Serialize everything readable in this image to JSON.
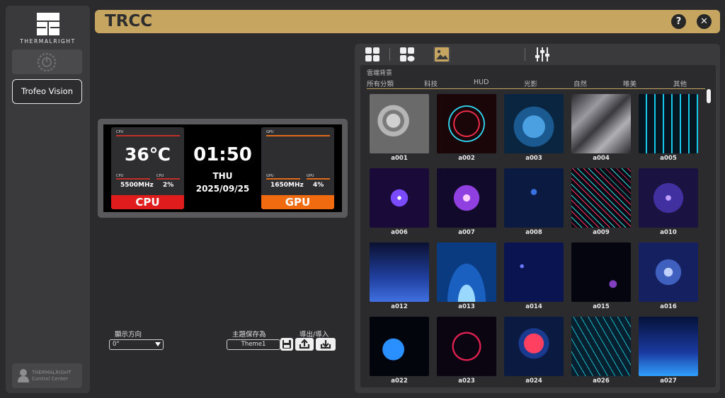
{
  "app": {
    "title": "TRCC"
  },
  "brand": {
    "logo_text": "THERMALRIGHT"
  },
  "sidebar": {
    "device_button_label": "Trofeo Vision",
    "control_center": {
      "line1": "THERMALRIGHT",
      "line2": "Control Center"
    }
  },
  "titlebar": {
    "help_symbol": "?",
    "close_symbol": "✕"
  },
  "preview": {
    "cpu": {
      "temp": "36℃",
      "freq": "5500MHz",
      "usage": "2%",
      "label": "CPU",
      "mini_top": "CPU",
      "mini_a": "CPU",
      "mini_b": "CPU"
    },
    "gpu": {
      "freq": "1650MHz",
      "usage": "4%",
      "label": "GPU",
      "mini_top": "GPU",
      "mini_a": "GPU",
      "mini_b": "GPU"
    },
    "time": "01:50",
    "day": "THU",
    "date": "2025/09/25"
  },
  "controls": {
    "orientation_label": "顯示方向",
    "orientation_value": "0°",
    "save_theme_label": "主題保存為",
    "theme_name": "Theme1",
    "export_import_label": "導出/導入"
  },
  "gallery": {
    "section_label": "雲端背景",
    "categories": [
      "所有分類",
      "科技",
      "HUD",
      "光影",
      "自然",
      "唯美",
      "其他"
    ],
    "items": [
      {
        "name": "a001",
        "bg": "#8a8a8a"
      },
      {
        "name": "a002",
        "bg": "#1a0508"
      },
      {
        "name": "a003",
        "bg": "#0a2540"
      },
      {
        "name": "a004",
        "bg": "#4a4a4e"
      },
      {
        "name": "a005",
        "bg": "#06141f"
      },
      {
        "name": "a006",
        "bg": "#1a0a3a"
      },
      {
        "name": "a007",
        "bg": "#120a2a"
      },
      {
        "name": "a008",
        "bg": "#0a1a40"
      },
      {
        "name": "a009",
        "bg": "#0a0a14"
      },
      {
        "name": "a010",
        "bg": "#1a1240"
      },
      {
        "name": "a012",
        "bg": "#0a1030"
      },
      {
        "name": "a013",
        "bg": "#0a3a80"
      },
      {
        "name": "a014",
        "bg": "#0a1450"
      },
      {
        "name": "a015",
        "bg": "#050510"
      },
      {
        "name": "a016",
        "bg": "#152060"
      },
      {
        "name": "a022",
        "bg": "#02060c"
      },
      {
        "name": "a023",
        "bg": "#0a0510"
      },
      {
        "name": "a024",
        "bg": "#0a1a40"
      },
      {
        "name": "a026",
        "bg": "#062030"
      },
      {
        "name": "a027",
        "bg": "#06123a"
      }
    ]
  }
}
